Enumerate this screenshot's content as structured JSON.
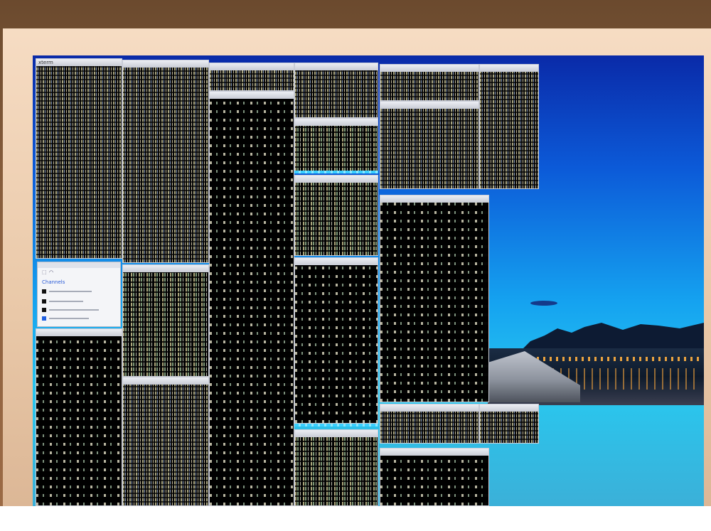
{
  "photo": {
    "subject": "monitor showing many tiled terminal windows over a city-at-dusk wallpaper"
  },
  "windows": [
    {
      "id": "col1-top",
      "title": "xterm"
    },
    {
      "id": "col1-bottom",
      "title": ""
    },
    {
      "id": "col2-top",
      "title": ""
    },
    {
      "id": "col2-mid",
      "title": ""
    },
    {
      "id": "col2-bottom",
      "title": ""
    },
    {
      "id": "col3-top",
      "title": ""
    },
    {
      "id": "col3-main",
      "title": ""
    },
    {
      "id": "col4-a",
      "title": ""
    },
    {
      "id": "col4-b",
      "title": ""
    },
    {
      "id": "col4-c",
      "title": ""
    },
    {
      "id": "col4-d",
      "title": ""
    },
    {
      "id": "col4-e",
      "title": ""
    },
    {
      "id": "col5-top",
      "title": ""
    },
    {
      "id": "col5-mid",
      "title": ""
    },
    {
      "id": "col5-tall",
      "title": ""
    },
    {
      "id": "col5-bottom",
      "title": ""
    },
    {
      "id": "col6-top",
      "title": ""
    }
  ],
  "panel": {
    "title": "",
    "label": "Channels"
  },
  "colors": {
    "bezel": "#e9c8a8",
    "terminal_bg": "#040404",
    "titlebar": "#d6d9e2",
    "wallpaper_sky": "#15a3f0",
    "accent_cyan": "#3ad0ff"
  }
}
